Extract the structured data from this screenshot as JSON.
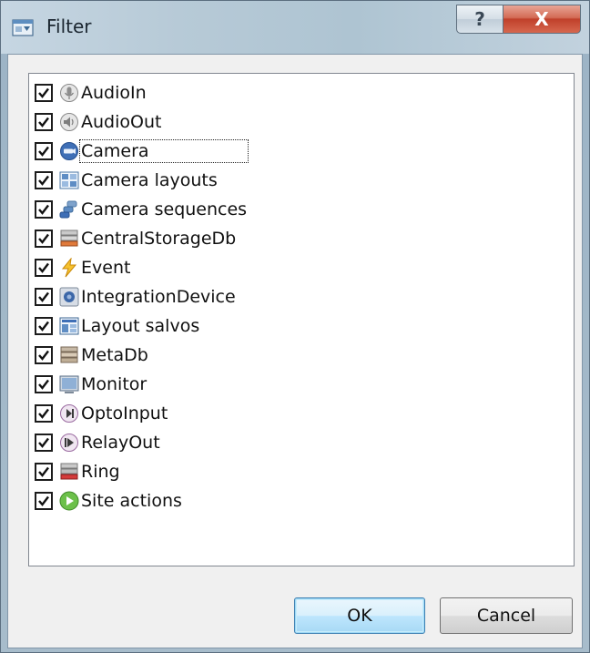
{
  "window": {
    "title": "Filter",
    "help_label": "?",
    "close_label": "X"
  },
  "list": {
    "items": [
      {
        "label": "AudioIn",
        "checked": true,
        "icon": "microphone-icon"
      },
      {
        "label": "AudioOut",
        "checked": true,
        "icon": "speaker-icon"
      },
      {
        "label": "Camera",
        "checked": true,
        "icon": "camera-icon",
        "focused": true
      },
      {
        "label": "Camera layouts",
        "checked": true,
        "icon": "layout-grid-icon"
      },
      {
        "label": "Camera sequences",
        "checked": true,
        "icon": "sequence-icon"
      },
      {
        "label": "CentralStorageDb",
        "checked": true,
        "icon": "database-icon"
      },
      {
        "label": "Event",
        "checked": true,
        "icon": "lightning-icon"
      },
      {
        "label": "IntegrationDevice",
        "checked": true,
        "icon": "gear-device-icon"
      },
      {
        "label": "Layout salvos",
        "checked": true,
        "icon": "layout-salvo-icon"
      },
      {
        "label": "MetaDb",
        "checked": true,
        "icon": "metadb-icon"
      },
      {
        "label": "Monitor",
        "checked": true,
        "icon": "monitor-icon"
      },
      {
        "label": "OptoInput",
        "checked": true,
        "icon": "opto-input-icon"
      },
      {
        "label": "RelayOut",
        "checked": true,
        "icon": "relay-out-icon"
      },
      {
        "label": "Ring",
        "checked": true,
        "icon": "ring-icon"
      },
      {
        "label": "Site actions",
        "checked": true,
        "icon": "play-circle-icon"
      }
    ]
  },
  "buttons": {
    "ok_label": "OK",
    "cancel_label": "Cancel"
  },
  "colors": {
    "accent": "#3c7fb1",
    "close": "#c0402a",
    "list_bg": "#ffffff"
  }
}
